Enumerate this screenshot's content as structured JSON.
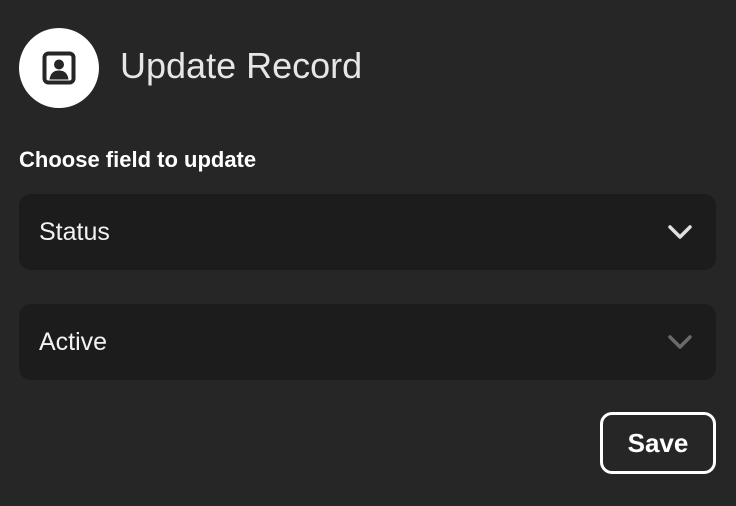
{
  "header": {
    "icon": "contact-card-icon",
    "title": "Update Record"
  },
  "form": {
    "field_label": "Choose field to update",
    "field_select": {
      "selected": "Status",
      "icon": "chevron-down-icon"
    },
    "value_select": {
      "selected": "Active",
      "icon": "chevron-down-icon",
      "state": "dimmed chevron"
    },
    "save_label": "Save"
  },
  "colors": {
    "background": "#262626",
    "select_background": "#1c1c1c",
    "text": "#ffffff",
    "title_text": "#e6e6e6",
    "chevron_active": "#e0e0e0",
    "chevron_dim": "#6a6a6a"
  }
}
